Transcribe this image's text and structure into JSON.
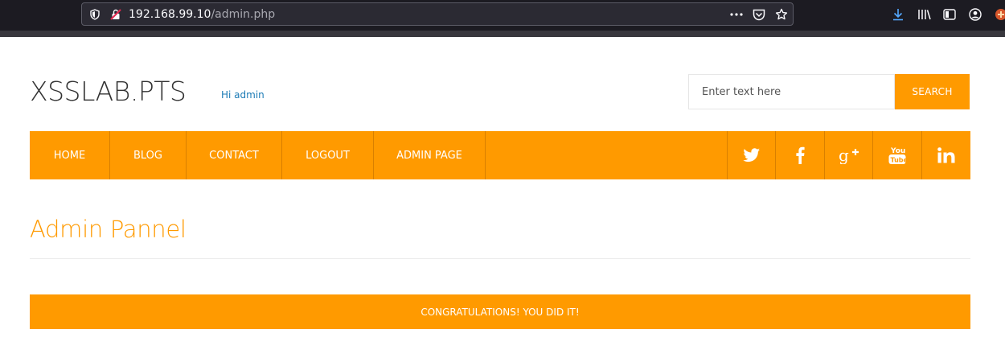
{
  "browser": {
    "url_host": "192.168.99.10",
    "url_path": "/admin.php"
  },
  "site": {
    "logo": "XSSLAB.PTS",
    "greeting": "Hi admin"
  },
  "search": {
    "placeholder": "Enter text here",
    "button_label": "SEARCH"
  },
  "nav": {
    "items": [
      {
        "label": "HOME"
      },
      {
        "label": "BLOG"
      },
      {
        "label": "CONTACT"
      },
      {
        "label": "LOGOUT"
      },
      {
        "label": "ADMIN PAGE"
      }
    ],
    "social": [
      "twitter-icon",
      "facebook-icon",
      "google-plus-icon",
      "youtube-icon",
      "linkedin-icon"
    ]
  },
  "main": {
    "title": "Admin Pannel",
    "banner": "CONGRATULATIONS! YOU DID IT!"
  },
  "colors": {
    "accent": "#ff9a00",
    "link": "#1a7ab5"
  }
}
